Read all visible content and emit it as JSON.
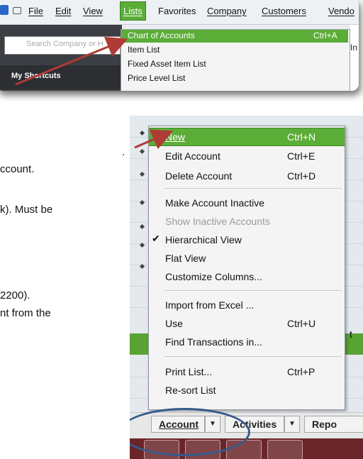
{
  "document": {
    "lines": [
      ".",
      "ccount.",
      "k).  Must be",
      "2200).",
      "nt from the"
    ]
  },
  "menubar": {
    "items": [
      "File",
      "Edit",
      "View",
      "Lists",
      "Favorites",
      "Company",
      "Customers",
      "Vendo"
    ],
    "active": "Lists"
  },
  "sidebar": {
    "search_placeholder": "Search Company or H",
    "shortcuts_label": "My Shortcuts",
    "fragment": "In"
  },
  "lists_menu": {
    "items": [
      {
        "label": "Chart of Accounts",
        "shortcut": "Ctrl+A",
        "highlighted": true
      },
      {
        "label": "Item List",
        "shortcut": ""
      },
      {
        "label": "Fixed Asset Item List",
        "shortcut": ""
      },
      {
        "label": "Price Level List",
        "shortcut": ""
      }
    ]
  },
  "account_menu": {
    "items": [
      {
        "label": "New",
        "shortcut": "Ctrl+N",
        "highlighted": true
      },
      {
        "label": "Edit Account",
        "shortcut": "Ctrl+E"
      },
      {
        "label": "Delete Account",
        "shortcut": "Ctrl+D"
      },
      {
        "label": "Make Account Inactive",
        "shortcut": ""
      },
      {
        "label": "Show Inactive Accounts",
        "shortcut": "",
        "disabled": true
      },
      {
        "label": "Hierarchical View",
        "shortcut": "",
        "checked": true
      },
      {
        "label": "Flat View",
        "shortcut": ""
      },
      {
        "label": "Customize Columns...",
        "shortcut": ""
      },
      {
        "label": "Import from Excel ...",
        "shortcut": ""
      },
      {
        "label": "Use",
        "shortcut": "Ctrl+U"
      },
      {
        "label": "Find Transactions in...",
        "shortcut": ""
      },
      {
        "label": "Print List...",
        "shortcut": "Ctrl+P"
      },
      {
        "label": "Re-sort List",
        "shortcut": ""
      }
    ],
    "row_fragment": "t"
  },
  "bottom_bar": {
    "account_label": "Account",
    "activities_label": "Activities",
    "reports_label": "Repo",
    "dropdown_glyph": "▼"
  },
  "colors": {
    "menu_highlight": "#5bad38",
    "annotation_arrow": "#b03a35",
    "annotation_ellipse": "#355a8c"
  }
}
